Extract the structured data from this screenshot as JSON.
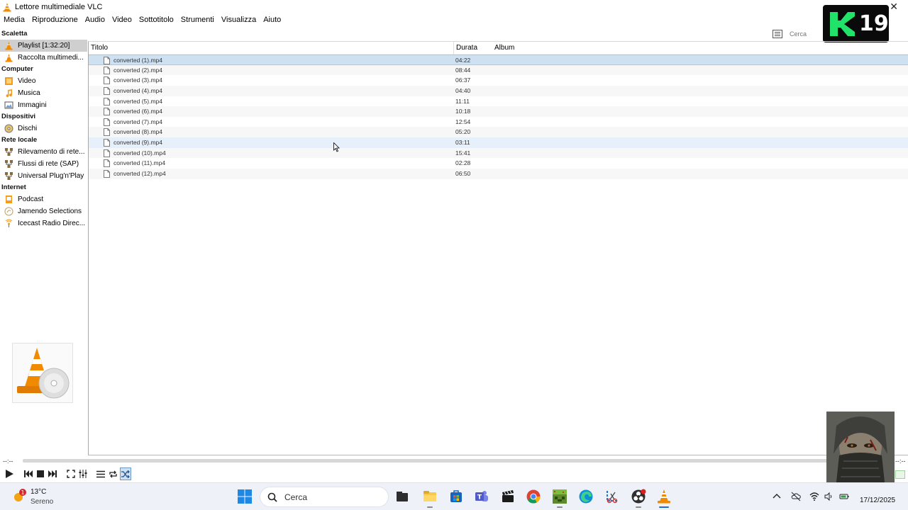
{
  "window": {
    "title": "Lettore multimediale VLC"
  },
  "menu": [
    "Media",
    "Riproduzione",
    "Audio",
    "Video",
    "Sottotitolo",
    "Strumenti",
    "Visualizza",
    "Aiuto"
  ],
  "overlay_badge": {
    "text": "19"
  },
  "search": {
    "placeholder": "Cerca"
  },
  "sidebar": {
    "scaletta": {
      "label": "Scaletta",
      "items": [
        {
          "label": "Playlist [1:32:20]",
          "icon": "playlist-icon",
          "selected": true
        },
        {
          "label": "Raccolta multimedi...",
          "icon": "media-library-icon"
        }
      ]
    },
    "computer": {
      "label": "Computer",
      "items": [
        {
          "label": "Video",
          "icon": "video-folder-icon"
        },
        {
          "label": "Musica",
          "icon": "music-icon"
        },
        {
          "label": "Immagini",
          "icon": "pictures-icon"
        }
      ]
    },
    "dispositivi": {
      "label": "Dispositivi",
      "items": [
        {
          "label": "Dischi",
          "icon": "disc-icon"
        }
      ]
    },
    "rete_locale": {
      "label": "Rete locale",
      "items": [
        {
          "label": "Rilevamento di rete...",
          "icon": "network-icon"
        },
        {
          "label": "Flussi di rete (SAP)",
          "icon": "network-icon"
        },
        {
          "label": "Universal Plug'n'Play",
          "icon": "network-icon"
        }
      ]
    },
    "internet": {
      "label": "Internet",
      "items": [
        {
          "label": "Podcast",
          "icon": "podcast-icon"
        },
        {
          "label": "Jamendo Selections",
          "icon": "jamendo-icon"
        },
        {
          "label": "Icecast Radio Direc...",
          "icon": "radio-icon"
        }
      ]
    }
  },
  "playlist": {
    "columns": {
      "title": "Titolo",
      "duration": "Durata",
      "album": "Album"
    },
    "rows": [
      {
        "title": "converted (1).mp4",
        "duration": "04:22"
      },
      {
        "title": "converted (2).mp4",
        "duration": "08:44"
      },
      {
        "title": "converted (3).mp4",
        "duration": "06:37"
      },
      {
        "title": "converted (4).mp4",
        "duration": "04:40"
      },
      {
        "title": "converted (5).mp4",
        "duration": "11:11"
      },
      {
        "title": "converted (6).mp4",
        "duration": "10:18"
      },
      {
        "title": "converted (7).mp4",
        "duration": "12:54"
      },
      {
        "title": "converted (8).mp4",
        "duration": "05:20"
      },
      {
        "title": "converted (9).mp4",
        "duration": "03:11"
      },
      {
        "title": "converted (10).mp4",
        "duration": "15:41"
      },
      {
        "title": "converted (11).mp4",
        "duration": "02:28"
      },
      {
        "title": "converted (12).mp4",
        "duration": "06:50"
      }
    ],
    "selected_index": 0,
    "hover_index": 8
  },
  "player": {
    "time_elapsed": "--:--",
    "time_total": "--:--"
  },
  "taskbar": {
    "weather": {
      "temperature": "13°C",
      "condition": "Sereno",
      "badge": "1"
    },
    "search_label": "Cerca",
    "date": "17/12/2025",
    "apps": [
      "file-explorer-dark-icon",
      "file-explorer-icon",
      "store-icon",
      "teams-icon",
      "clapper-icon",
      "chrome-icon",
      "minecraft-icon",
      "edge-icon",
      "snipping-tool-icon",
      "obs-icon",
      "vlc-icon"
    ]
  },
  "colors": {
    "selection": "#cde1f3",
    "vlc_orange": "#f08a00",
    "badge_green": "#22e36a"
  }
}
